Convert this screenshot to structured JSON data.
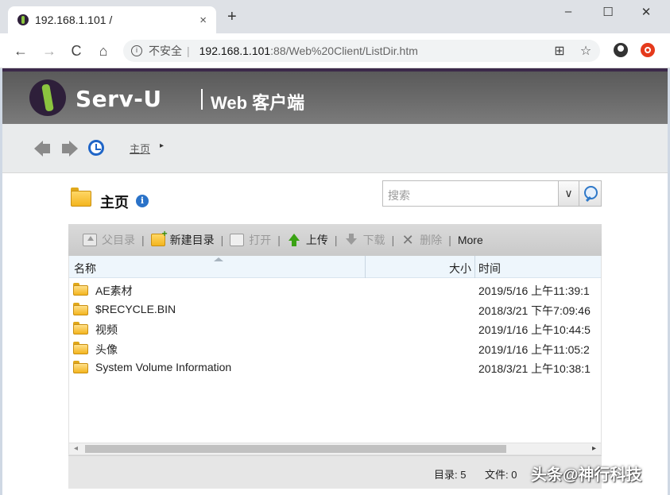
{
  "browser": {
    "tab_title": "192.168.1.101 /",
    "tab_close": "×",
    "new_tab": "+",
    "window_controls": {
      "minimize": "–",
      "maximize": "☐",
      "close": "✕"
    },
    "nav": {
      "back": "←",
      "forward": "→",
      "reload": "C",
      "home": "⌂"
    },
    "address": {
      "info_glyph": "i",
      "security_label": "不安全",
      "separator": "|",
      "host": "192.168.1.101",
      "rest": ":88/Web%20Client/ListDir.htm"
    },
    "right_icons": {
      "translate": "⊞",
      "bookmark": "☆"
    }
  },
  "header": {
    "brand": "Serv-U",
    "subtitle": "Web 客户端"
  },
  "breadcrumb": {
    "home_label": "主页",
    "caret": "▸"
  },
  "folder": {
    "title": "主页",
    "info_glyph": "i"
  },
  "search": {
    "placeholder": "搜索",
    "dropdown_glyph": "∨"
  },
  "toolbar": {
    "parent_label": "父目录",
    "new_dir_label": "新建目录",
    "open_label": "打开",
    "upload_label": "上传",
    "download_label": "下载",
    "delete_label": "删除",
    "more_label": "More",
    "separator": "|"
  },
  "filelist": {
    "columns": {
      "name": "名称",
      "size": "大小",
      "time": "时间"
    },
    "rows": [
      {
        "name": "AE素材",
        "size": "",
        "time": "2019/5/16 上午11:39:1"
      },
      {
        "name": "$RECYCLE.BIN",
        "size": "",
        "time": "2018/3/21 下午7:09:46"
      },
      {
        "name": "视频",
        "size": "",
        "time": "2019/1/16 上午10:44:5"
      },
      {
        "name": "头像",
        "size": "",
        "time": "2019/1/16 上午11:05:2"
      },
      {
        "name": "System Volume Information",
        "size": "",
        "time": "2018/3/21 上午10:38:1"
      }
    ]
  },
  "scroll": {
    "left": "◂",
    "right": "▸"
  },
  "status": {
    "dirs": "目录: 5",
    "files": "文件: 0"
  },
  "watermark": "头条@神行科技"
}
